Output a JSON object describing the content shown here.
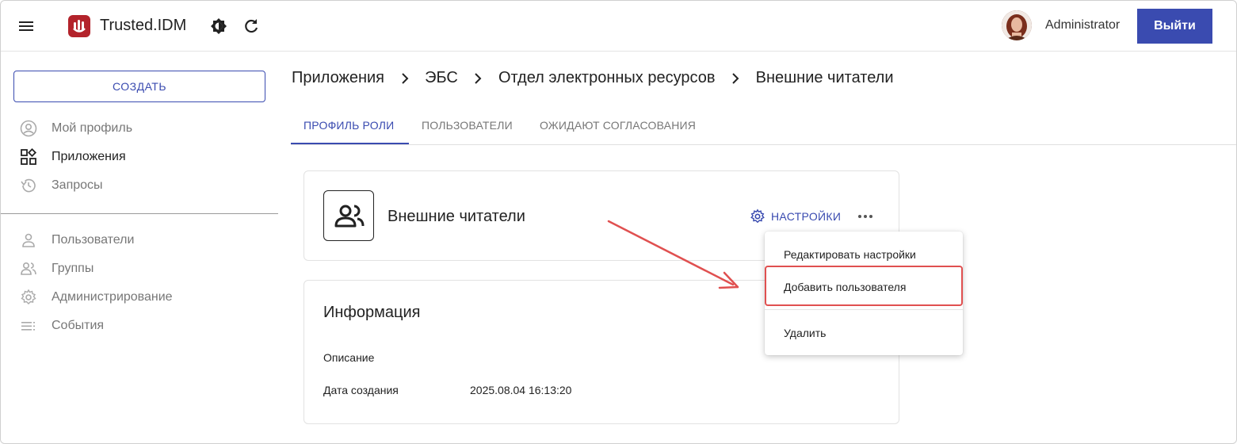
{
  "header": {
    "app_title": "Trusted.IDM",
    "user_name": "Administrator",
    "logout_label": "Выйти"
  },
  "sidebar": {
    "create_label": "СОЗДАТЬ",
    "items": [
      {
        "label": "Мой профиль",
        "icon": "account-circle-icon"
      },
      {
        "label": "Приложения",
        "icon": "apps-icon"
      },
      {
        "label": "Запросы",
        "icon": "history-icon"
      },
      {
        "label": "Пользователи",
        "icon": "person-icon"
      },
      {
        "label": "Группы",
        "icon": "group-icon"
      },
      {
        "label": "Администрирование",
        "icon": "gear-icon"
      },
      {
        "label": "События",
        "icon": "list-icon"
      }
    ]
  },
  "breadcrumb": [
    "Приложения",
    "ЭБС",
    "Отдел электронных ресурсов",
    "Внешние читатели"
  ],
  "tabs": [
    "ПРОФИЛЬ РОЛИ",
    "ПОЛЬЗОВАТЕЛИ",
    "ОЖИДАЮТ СОГЛАСОВАНИЯ"
  ],
  "role": {
    "name": "Внешние читатели",
    "settings_label": "НАСТРОЙКИ"
  },
  "dropdown": {
    "items": [
      "Редактировать настройки",
      "Добавить пользователя",
      "Удалить"
    ]
  },
  "info": {
    "title": "Информация",
    "description_label": "Описание",
    "description_value": "",
    "created_label": "Дата создания",
    "created_value": "2025.08.04 16:13:20"
  },
  "colors": {
    "accent": "#3a4bb0",
    "brand": "#b3232b",
    "annotation": "#e05050"
  }
}
